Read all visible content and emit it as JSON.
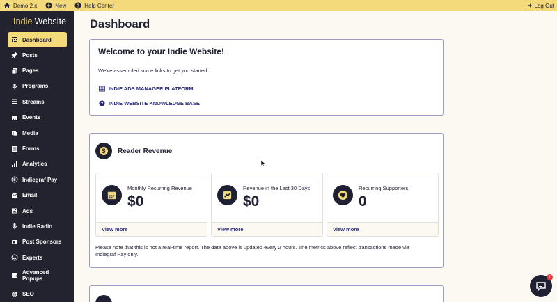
{
  "topbar": {
    "site": "Demo 2.x",
    "new": "New",
    "help": "Help Center",
    "logout": "Log Out"
  },
  "brand": {
    "part1": "Indie",
    "part2": "Website"
  },
  "sidebar": {
    "items": [
      {
        "label": "Dashboard",
        "icon": "dashboard-icon"
      },
      {
        "label": "Posts",
        "icon": "pin-icon"
      },
      {
        "label": "Pages",
        "icon": "pages-icon"
      },
      {
        "label": "Programs",
        "icon": "microphone-icon"
      },
      {
        "label": "Streams",
        "icon": "streams-icon"
      },
      {
        "label": "Events",
        "icon": "calendar-icon"
      },
      {
        "label": "Media",
        "icon": "media-icon"
      },
      {
        "label": "Forms",
        "icon": "forms-icon"
      },
      {
        "label": "Analytics",
        "icon": "analytics-icon"
      },
      {
        "label": "Indiegraf Pay",
        "icon": "dollar-icon"
      },
      {
        "label": "Email",
        "icon": "email-icon"
      },
      {
        "label": "Ads",
        "icon": "ads-icon"
      },
      {
        "label": "Indie Radio",
        "icon": "radio-icon"
      },
      {
        "label": "Post Sponsors",
        "icon": "sponsors-icon"
      },
      {
        "label": "Experts",
        "icon": "experts-icon"
      },
      {
        "label": "Advanced",
        "label2": "Popups",
        "icon": "popups-icon"
      },
      {
        "label": "SEO",
        "icon": "seo-icon"
      }
    ]
  },
  "main": {
    "title": "Dashboard",
    "welcome": {
      "heading": "Welcome to your Indie Website!",
      "intro": "We've assembled some links to get you started:",
      "link1": "INDIE ADS MANAGER PLATFORM",
      "link2": "INDIE WEBSITE KNOWLEDGE BASE"
    },
    "revenue": {
      "heading": "Reader Revenue",
      "stats": [
        {
          "label": "Monthly Recurring Revenue",
          "value": "$0",
          "link": "View more"
        },
        {
          "label": "Revenue in the Last 30 Days",
          "value": "$0",
          "link": "View more"
        },
        {
          "label": "Recurring Supporters",
          "value": "0",
          "link": "View more"
        }
      ],
      "note": "Please note that this is not a real-time report. The data above is updated every 2 hours. The metrics above reflect transactions made via Indiegraf Pay only."
    }
  },
  "chat": {
    "badge": "1"
  },
  "colors": {
    "accent": "#f4da7a",
    "sidebar": "#23232f",
    "link": "#2a2a7a"
  }
}
